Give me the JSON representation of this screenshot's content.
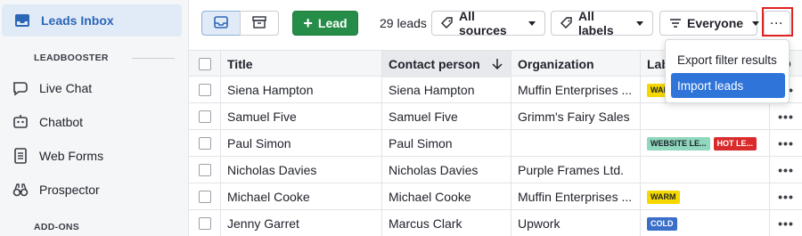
{
  "colors": {
    "accent": "#2c66b6",
    "primary_button": "#268d49",
    "highlight_border": "#e0231f",
    "menu_selected": "#2f74d9"
  },
  "sidebar": {
    "active_item": {
      "label": "Leads Inbox",
      "icon": "inbox-icon"
    },
    "sections": [
      {
        "heading": "LEADBOOSTER"
      },
      {
        "heading": "ADD-ONS"
      }
    ],
    "items": [
      {
        "label": "Live Chat",
        "icon": "chat-bubble-icon"
      },
      {
        "label": "Chatbot",
        "icon": "chatbot-icon"
      },
      {
        "label": "Web Forms",
        "icon": "web-forms-icon"
      },
      {
        "label": "Prospector",
        "icon": "binoculars-icon"
      }
    ]
  },
  "toolbar": {
    "view_list_icon": "inbox-icon",
    "view_archive_icon": "archive-icon",
    "add_lead_label": "Lead",
    "count_label": "29 leads",
    "sources_filter": "All sources",
    "labels_filter": "All labels",
    "owner_filter": "Everyone",
    "more_label": "···"
  },
  "menu": {
    "items": [
      {
        "label": "Export filter results"
      },
      {
        "label": "Import leads"
      }
    ]
  },
  "table": {
    "columns": {
      "title": "Title",
      "contact": "Contact person",
      "organization": "Organization",
      "labels": "Labels"
    },
    "rows": [
      {
        "title": "Siena Hampton",
        "contact": "Siena Hampton",
        "organization": "Muffin Enterprises ...",
        "labels": [
          {
            "text": "WARM",
            "bg": "#f5d800",
            "fg": "#21232c"
          }
        ]
      },
      {
        "title": "Samuel Five",
        "contact": "Samuel Five",
        "organization": "Grimm's Fairy Sales",
        "labels": []
      },
      {
        "title": "Paul Simon",
        "contact": "Paul Simon",
        "organization": "",
        "labels": [
          {
            "text": "WEBSITE LE...",
            "bg": "#8fd7bd",
            "fg": "#21232c"
          },
          {
            "text": "HOT LE...",
            "bg": "#d92b2b",
            "fg": "#ffffff"
          }
        ]
      },
      {
        "title": "Nicholas Davies",
        "contact": "Nicholas Davies",
        "organization": "Purple Frames Ltd.",
        "labels": []
      },
      {
        "title": "Michael Cooke",
        "contact": "Michael Cooke",
        "organization": "Muffin Enterprises ...",
        "labels": [
          {
            "text": "WARM",
            "bg": "#f5d800",
            "fg": "#21232c"
          }
        ]
      },
      {
        "title": "Jenny Garret",
        "contact": "Marcus Clark",
        "organization": "Upwork",
        "labels": [
          {
            "text": "COLD",
            "bg": "#3a6fc9",
            "fg": "#ffffff"
          }
        ]
      }
    ],
    "row_more_label": "•••"
  }
}
